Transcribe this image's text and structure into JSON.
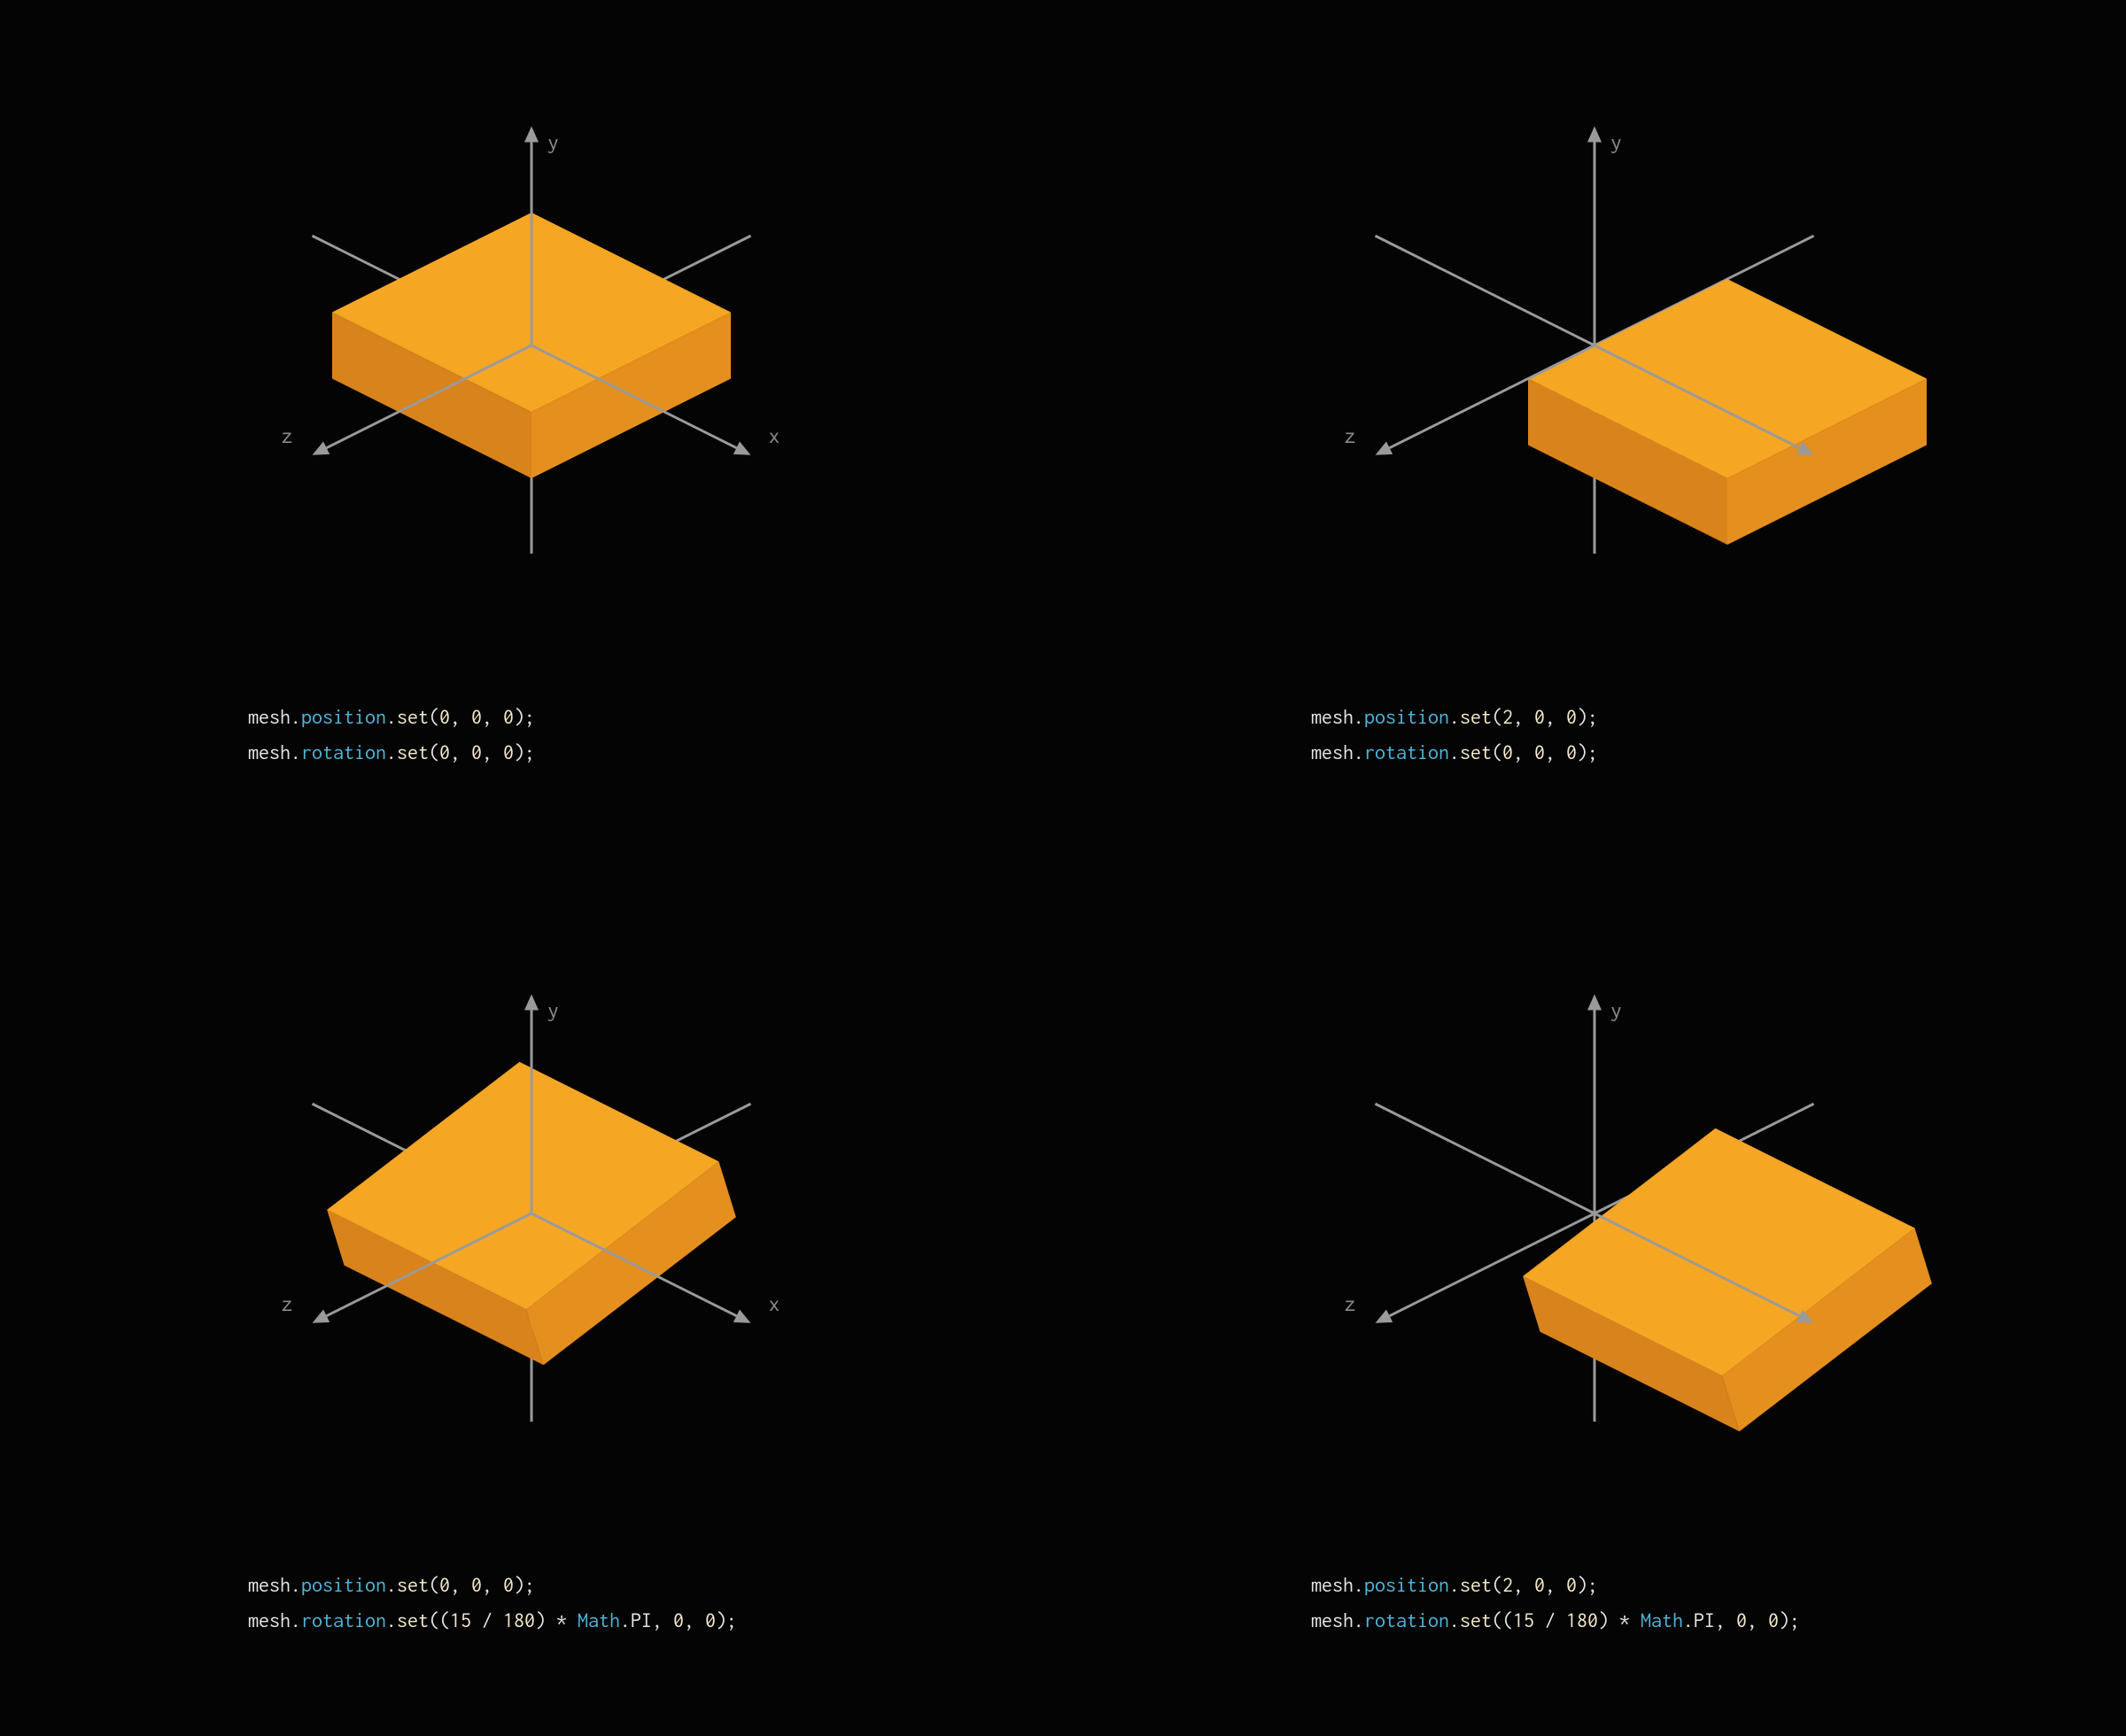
{
  "panels": [
    {
      "id": "tl",
      "position": [
        0,
        0,
        0
      ],
      "rotation_deg": [
        0,
        0,
        0
      ],
      "show_x_label": true,
      "code": {
        "line1": {
          "obj": "mesh",
          "prop": "position",
          "fn": "set",
          "args": "0, 0, 0"
        },
        "line2": {
          "obj": "mesh",
          "prop": "rotation",
          "fn": "set",
          "args": "0, 0, 0"
        }
      }
    },
    {
      "id": "tr",
      "position": [
        2,
        0,
        0
      ],
      "rotation_deg": [
        0,
        0,
        0
      ],
      "show_x_label": false,
      "code": {
        "line1": {
          "obj": "mesh",
          "prop": "position",
          "fn": "set",
          "args": "2, 0, 0"
        },
        "line2": {
          "obj": "mesh",
          "prop": "rotation",
          "fn": "set",
          "args": "0, 0, 0"
        }
      }
    },
    {
      "id": "bl",
      "position": [
        0,
        0,
        0
      ],
      "rotation_deg": [
        15,
        0,
        0
      ],
      "show_x_label": true,
      "code": {
        "line1": {
          "obj": "mesh",
          "prop": "position",
          "fn": "set",
          "args": "0, 0, 0"
        },
        "line2": {
          "obj": "mesh",
          "prop": "rotation",
          "fn": "set",
          "args_raw": "(15 / 180) * Math.PI, 0, 0"
        }
      }
    },
    {
      "id": "br",
      "position": [
        2,
        0,
        0
      ],
      "rotation_deg": [
        15,
        0,
        0
      ],
      "show_x_label": false,
      "code": {
        "line1": {
          "obj": "mesh",
          "prop": "position",
          "fn": "set",
          "args": "2, 0, 0"
        },
        "line2": {
          "obj": "mesh",
          "prop": "rotation",
          "fn": "set",
          "args_raw": "(15 / 180) * Math.PI, 0, 0"
        }
      }
    }
  ],
  "axis_labels": {
    "x": "x",
    "y": "y",
    "z": "z"
  },
  "box": {
    "width": 3,
    "height": 1,
    "depth": 3
  },
  "iso": {
    "scale": 75,
    "x_dx": 1,
    "x_dy": 0.5,
    "z_dx": -1,
    "z_dy": 0.5,
    "y_dy": -1
  }
}
